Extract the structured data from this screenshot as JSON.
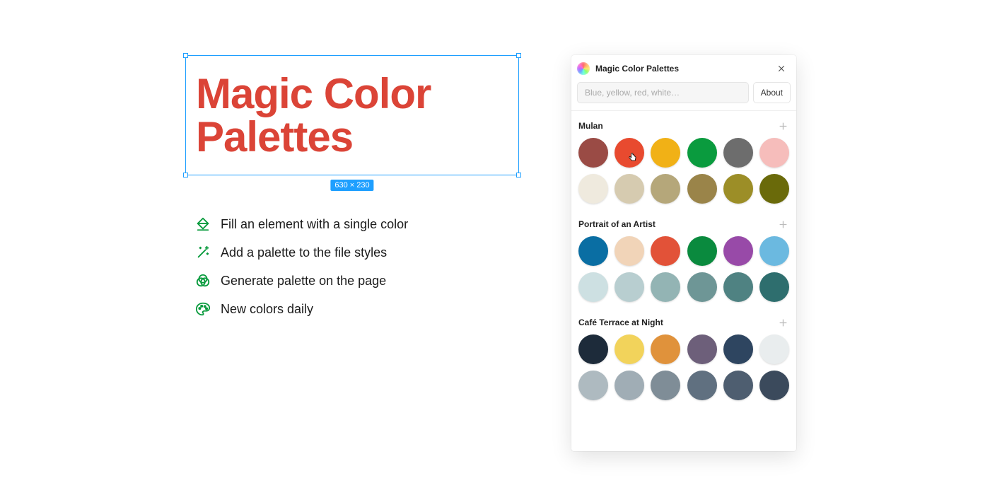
{
  "headline": "Magic Color Palettes",
  "headline_color": "#db4437",
  "selection_dims": "630 × 230",
  "features": [
    {
      "icon": "fill-icon",
      "text": "Fill an element with a single color"
    },
    {
      "icon": "wand-icon",
      "text": "Add a palette to the file styles"
    },
    {
      "icon": "venn-icon",
      "text": "Generate palette on the page"
    },
    {
      "icon": "palette-icon",
      "text": "New colors daily"
    }
  ],
  "plugin": {
    "title": "Magic Color Palettes",
    "search_placeholder": "Blue, yellow, red, white…",
    "about_label": "About",
    "groups": [
      {
        "name": "Mulan",
        "colors": [
          "#9a4b45",
          "#e84a2f",
          "#f1b116",
          "#0a9b3e",
          "#6d6d6d",
          "#f6bdbb",
          "#efeade",
          "#d6cbb0",
          "#b5a77a",
          "#9a8449",
          "#9c8e27",
          "#6a6a0a"
        ],
        "cursor_on_index": 1
      },
      {
        "name": "Portrait of an Artist",
        "colors": [
          "#0a6ea3",
          "#f1d4b8",
          "#e25238",
          "#0a8a3e",
          "#984aa8",
          "#6bb9e0",
          "#cde0e2",
          "#b8ced0",
          "#93b4b4",
          "#6e9696",
          "#4f8282",
          "#2e6e6e"
        ]
      },
      {
        "name": "Café Terrace at Night",
        "colors": [
          "#1d2b3a",
          "#f2d35b",
          "#e0923b",
          "#6d5f7a",
          "#2e4560",
          "#e9edee",
          "#aebac0",
          "#a0adb5",
          "#7f8d97",
          "#607080",
          "#4e5e70",
          "#3b4a5c"
        ]
      }
    ]
  }
}
